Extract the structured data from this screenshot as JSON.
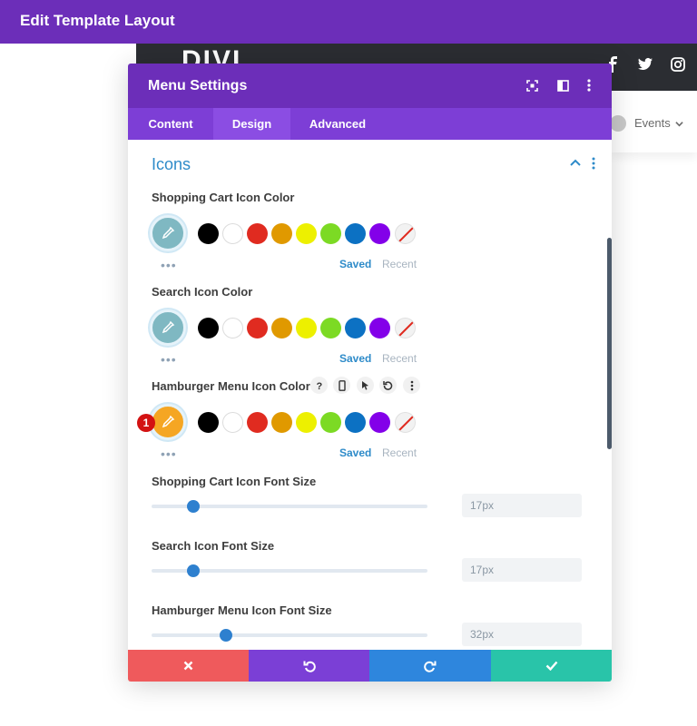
{
  "topbar": {
    "title": "Edit Template Layout"
  },
  "background_page": {
    "logo": "DIVI",
    "nav_item": "Events"
  },
  "modal": {
    "title": "Menu Settings",
    "tabs": [
      {
        "label": "Content",
        "active": false
      },
      {
        "label": "Design",
        "active": true
      },
      {
        "label": "Advanced",
        "active": false
      }
    ],
    "section_title": "Icons",
    "color_fields": [
      {
        "label": "Shopping Cart Icon Color",
        "picker_color": "#7fb8c2"
      },
      {
        "label": "Search Icon Color",
        "picker_color": "#7fb8c2"
      },
      {
        "label": "Hamburger Menu Icon Color",
        "picker_color": "#f5a623"
      }
    ],
    "palette": [
      "#000000",
      "#ffffff",
      "#e02b20",
      "#e09900",
      "#edf000",
      "#7cda24",
      "#0c71c3",
      "#8300e9"
    ],
    "saved_label": "Saved",
    "recent_label": "Recent",
    "step_badge": "1",
    "size_fields": [
      {
        "label": "Shopping Cart Icon Font Size",
        "value": "17px",
        "slider_fraction": 0.15
      },
      {
        "label": "Search Icon Font Size",
        "value": "17px",
        "slider_fraction": 0.15
      },
      {
        "label": "Hamburger Menu Icon Font Size",
        "value": "32px",
        "slider_fraction": 0.27
      }
    ]
  },
  "colors": {
    "brand_purple": "#6c2eb9",
    "tab_bar": "#7d3ed6",
    "accent_blue": "#2e8bc9",
    "cancel": "#ef5a5c",
    "undo": "#7b3fd6",
    "redo": "#2e86dd",
    "save": "#29c4a9"
  }
}
